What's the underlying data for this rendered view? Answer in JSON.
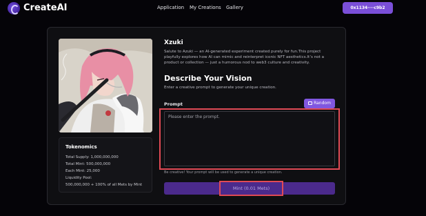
{
  "app": {
    "brand": "CreateAI",
    "nav": [
      "Application",
      "My Creations",
      "Gallery"
    ],
    "wallet": "0x1134····c9b2",
    "accent": "#7a4fd8"
  },
  "collection": {
    "title": "Xzuki",
    "description": "Salute to Azuki — an AI-generated experiment created purely for fun.This project playfully explores how AI can mimic and reinterpret iconic NFT aesthetics.It’s not a product or collection — just a humorous nod to web3 culture and creativity."
  },
  "tokenomics": {
    "title": "Tokenomics",
    "lines": [
      "Total Supply: 1,000,000,000",
      "Total Mint: 500,000,000",
      "Each Mint: 25,000",
      "Liquidity Pool:",
      "500,000,000 + 100% of all Mets by Mint"
    ]
  },
  "form": {
    "heading": "Describe Your Vision",
    "subheading": "Enter a creative prompt to generate your unique creation.",
    "prompt_label": "Prompt",
    "random_label": "Random",
    "random_icon": "dice-icon",
    "prompt_placeholder": "Please enter the prompt.",
    "hint": "Be creative! Your prompt will be used to generate a unique creation.",
    "mint_label": "Mint (0.01 Mets)"
  },
  "highlight_color": "#e14a55"
}
